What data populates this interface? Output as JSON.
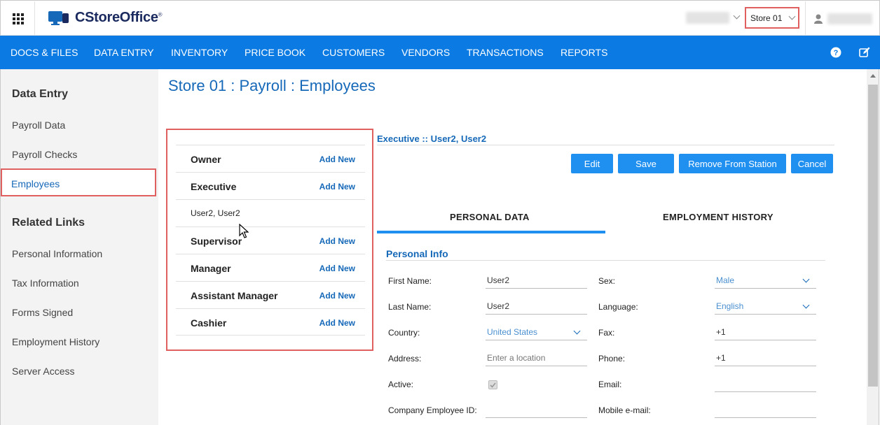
{
  "header": {
    "app_name": "CStoreOffice",
    "trademark": "®",
    "store_selected": "Store 01"
  },
  "nav": {
    "items": [
      "DOCS & FILES",
      "DATA ENTRY",
      "INVENTORY",
      "PRICE BOOK",
      "CUSTOMERS",
      "VENDORS",
      "TRANSACTIONS",
      "REPORTS"
    ],
    "help_icon": "help-icon",
    "edit_icon": "edit-icon"
  },
  "sidebar": {
    "section1_title": "Data Entry",
    "section1_items": [
      "Payroll Data",
      "Payroll Checks",
      "Employees"
    ],
    "section2_title": "Related Links",
    "section2_items": [
      "Personal Information",
      "Tax Information",
      "Forms Signed",
      "Employment History",
      "Server Access"
    ]
  },
  "page": {
    "title": "Store 01 : Payroll : Employees"
  },
  "employees_panel": {
    "add_label": "Add New",
    "groups": [
      "Owner",
      "Executive",
      "Supervisor",
      "Manager",
      "Assistant Manager",
      "Cashier"
    ],
    "executive_member": "User2, User2"
  },
  "detail": {
    "heading": "Executive :: User2, User2",
    "buttons": {
      "edit": "Edit",
      "save": "Save",
      "remove": "Remove From Station",
      "cancel": "Cancel"
    },
    "tabs": {
      "personal": "PERSONAL DATA",
      "history": "EMPLOYMENT HISTORY"
    },
    "section_title": "Personal Info",
    "fields": {
      "first_name_label": "First Name:",
      "first_name_value": "User2",
      "last_name_label": "Last Name:",
      "last_name_value": "User2",
      "country_label": "Country:",
      "country_value": "United States",
      "address_label": "Address:",
      "address_placeholder": "Enter a location",
      "active_label": "Active:",
      "company_id_label": "Company Employee ID:",
      "sex_label": "Sex:",
      "sex_value": "Male",
      "language_label": "Language:",
      "language_value": "English",
      "fax_label": "Fax:",
      "fax_value": "+1",
      "phone_label": "Phone:",
      "phone_value": "+1",
      "email_label": "Email:",
      "mobile_email_label": "Mobile e-mail:"
    }
  },
  "colors": {
    "nav_bg": "#0b7ae2",
    "accent": "#1669b8",
    "button": "#1f8ff0",
    "highlight_border": "#e06060"
  }
}
